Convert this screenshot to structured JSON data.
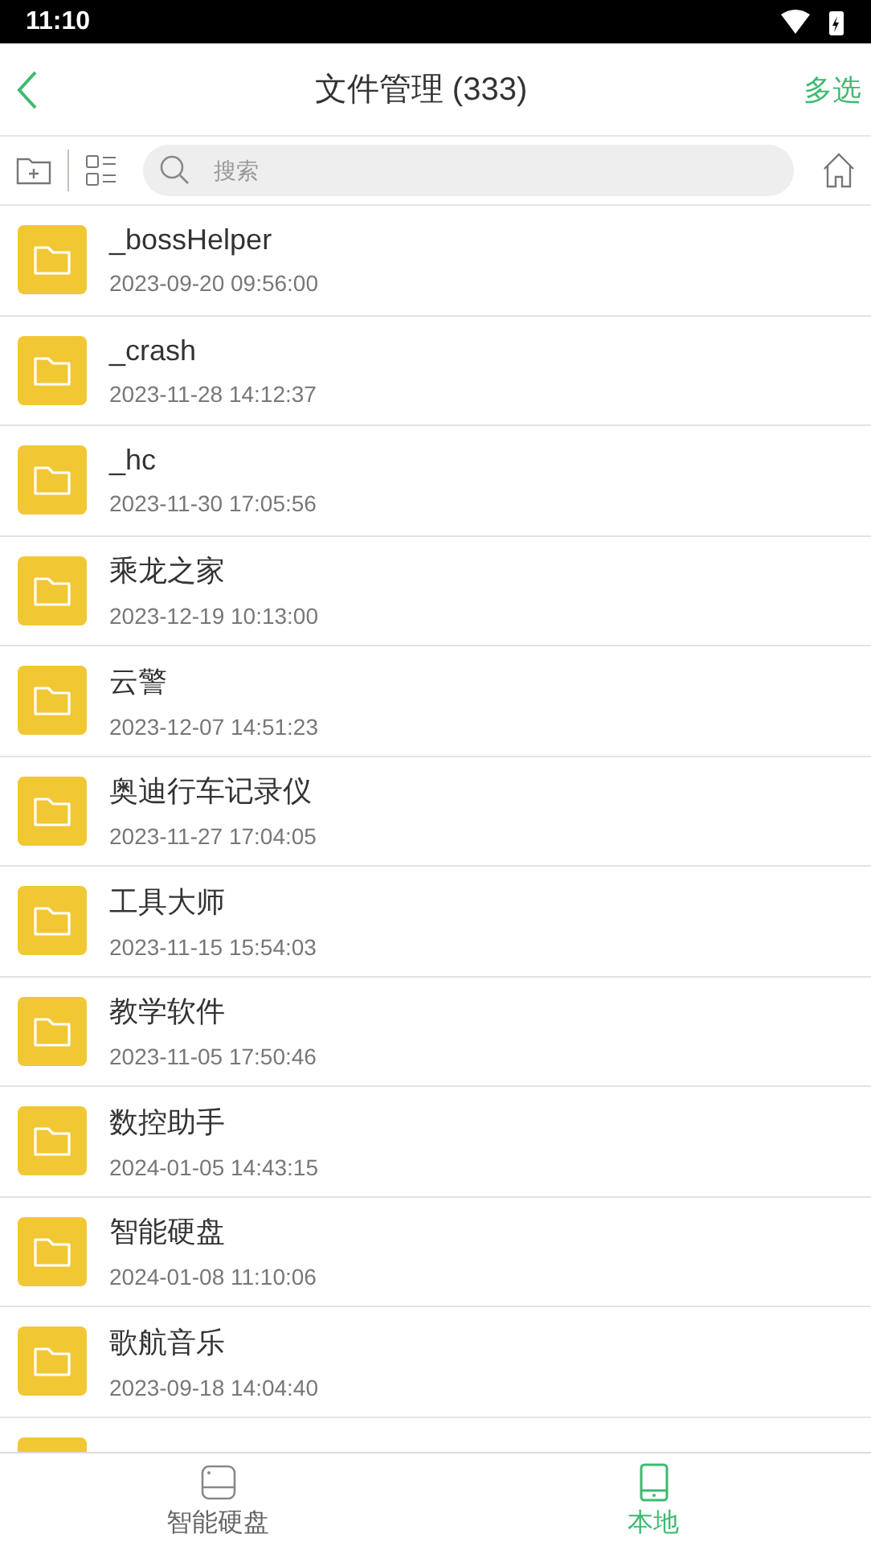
{
  "status_bar": {
    "time": "11:10"
  },
  "header": {
    "title": "文件管理 (333)",
    "action": "多选"
  },
  "search": {
    "placeholder": "搜索"
  },
  "files": [
    {
      "kind": "folder",
      "name": "_bossHelper",
      "date": "2023-09-20 09:56:00"
    },
    {
      "kind": "folder",
      "name": "_crash",
      "date": "2023-11-28 14:12:37"
    },
    {
      "kind": "folder",
      "name": "_hc",
      "date": "2023-11-30 17:05:56"
    },
    {
      "kind": "folder",
      "name": "乘龙之家",
      "date": "2023-12-19 10:13:00"
    },
    {
      "kind": "folder",
      "name": "云警",
      "date": "2023-12-07 14:51:23"
    },
    {
      "kind": "folder",
      "name": "奥迪行车记录仪",
      "date": "2023-11-27 17:04:05"
    },
    {
      "kind": "folder",
      "name": "工具大师",
      "date": "2023-11-15 15:54:03"
    },
    {
      "kind": "folder",
      "name": "教学软件",
      "date": "2023-11-05 17:50:46"
    },
    {
      "kind": "folder",
      "name": "数控助手",
      "date": "2024-01-05 14:43:15"
    },
    {
      "kind": "folder",
      "name": "智能硬盘",
      "date": "2024-01-08 11:10:06"
    },
    {
      "kind": "folder",
      "name": "歌航音乐",
      "date": "2023-09-18 14:04:40"
    },
    {
      "kind": "folder"
    }
  ],
  "bottom_nav": [
    {
      "kind": "disk",
      "label": "智能硬盘",
      "selected": false
    },
    {
      "kind": "phone",
      "label": "本地",
      "selected": true
    }
  ]
}
